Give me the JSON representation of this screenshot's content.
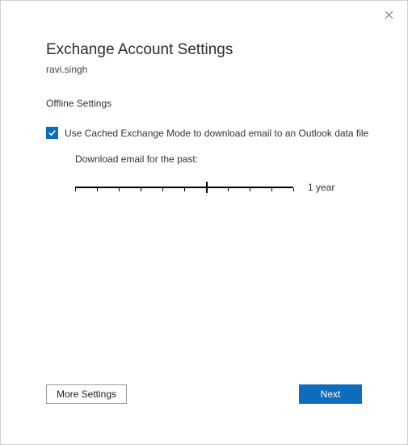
{
  "window": {
    "title": "Exchange Account Settings",
    "subtitle": "ravi.singh"
  },
  "offline_settings": {
    "section_label": "Offline Settings",
    "cached_mode": {
      "checked": true,
      "label": "Use Cached Exchange Mode to download email to an Outlook data file"
    },
    "slider": {
      "label": "Download email for the past:",
      "value_label": "1 year",
      "position_percent": 60
    }
  },
  "buttons": {
    "more_settings": "More Settings",
    "next": "Next"
  }
}
